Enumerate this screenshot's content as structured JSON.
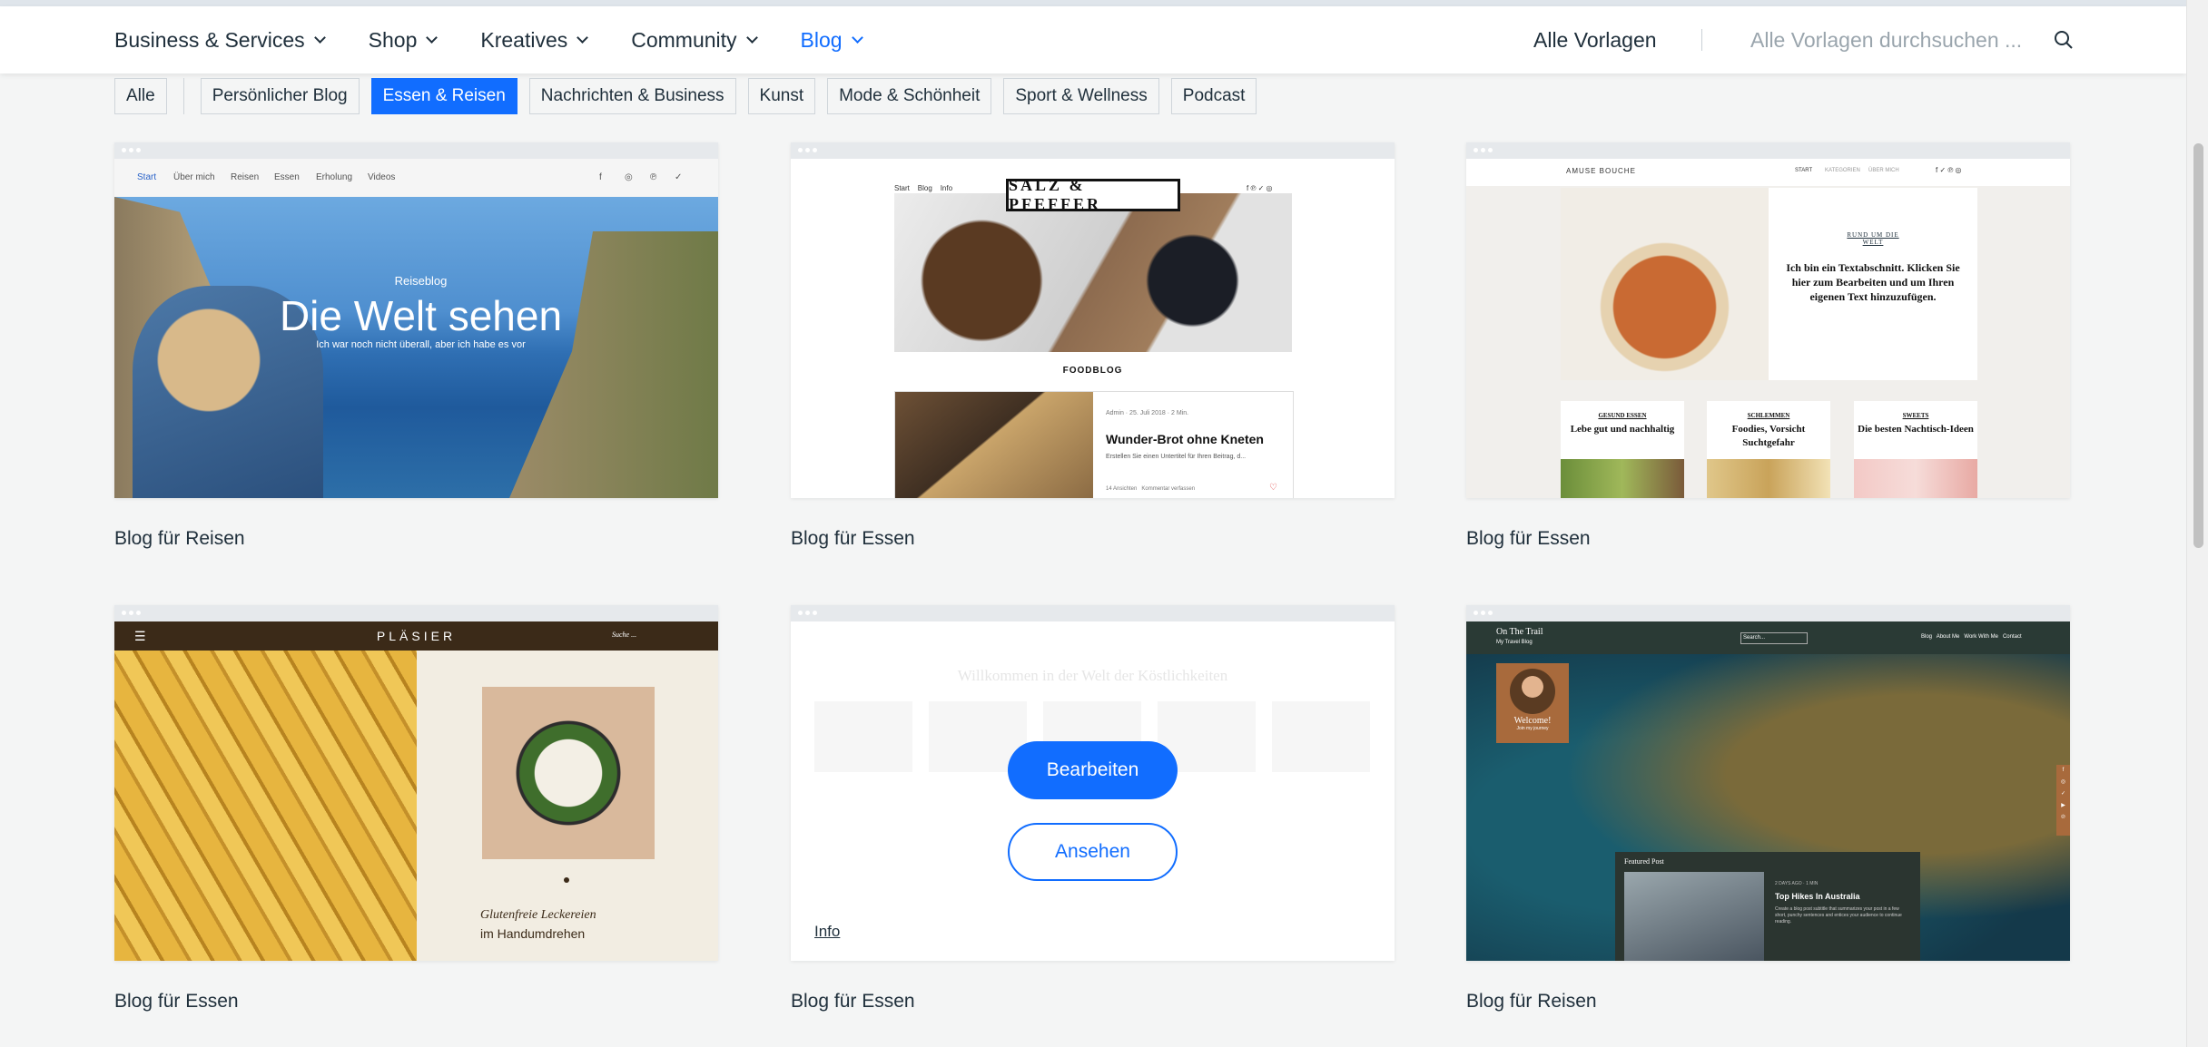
{
  "header": {
    "nav": [
      {
        "label": "Business & Services"
      },
      {
        "label": "Shop"
      },
      {
        "label": "Kreatives"
      },
      {
        "label": "Community"
      },
      {
        "label": "Blog"
      }
    ],
    "active_nav": "Blog",
    "all_templates": "Alle Vorlagen",
    "search_placeholder": "Alle Vorlagen durchsuchen ..."
  },
  "filters": {
    "all": "Alle",
    "items": [
      {
        "label": "Persönlicher Blog"
      },
      {
        "label": "Essen & Reisen"
      },
      {
        "label": "Nachrichten & Business"
      },
      {
        "label": "Kunst"
      },
      {
        "label": "Mode & Schönheit"
      },
      {
        "label": "Sport & Wellness"
      },
      {
        "label": "Podcast"
      }
    ],
    "active": "Essen & Reisen"
  },
  "cards": [
    {
      "title": "Blog für Reisen",
      "preview": {
        "nav": [
          "Start",
          "Über mich",
          "Reisen",
          "Essen",
          "Erholung",
          "Videos"
        ],
        "kicker": "Reiseblog",
        "headline": "Die Welt sehen",
        "tagline": "Ich war noch nicht überall, aber ich habe es vor"
      }
    },
    {
      "title": "Blog für Essen",
      "preview": {
        "nav": [
          "Start",
          "Blog",
          "Info"
        ],
        "logo": "SALZ & PFEFFER",
        "section": "FOODBLOG",
        "post_meta": "Admin · 25. Juli 2018 · 2 Min.",
        "post_title": "Wunder-Brot ohne Kneten",
        "post_excerpt": "Erstellen Sie einen Untertitel für Ihren Beitrag, d...",
        "post_stats": "14 Ansichten",
        "post_comments": "Kommentar verfassen"
      }
    },
    {
      "title": "Blog für Essen",
      "preview": {
        "brand": "AMUSE BOUCHE",
        "nav": [
          "START",
          "KATEGORIEN",
          "ÜBER MICH"
        ],
        "kicker": "RUND UM DIE WELT",
        "text": "Ich bin ein Textabschnitt. Klicken Sie hier zum Bearbeiten und um Ihren eigenen Text hinzuzufügen.",
        "cards": [
          {
            "label": "GESUND ESSEN",
            "title": "Lebe gut und nachhaltig"
          },
          {
            "label": "SCHLEMMEN",
            "title": "Foodies, Vorsicht Suchtgefahr"
          },
          {
            "label": "SWEETS",
            "title": "Die besten Nachtisch-Ideen"
          }
        ]
      }
    },
    {
      "title": "Blog für Essen",
      "preview": {
        "brand": "PLÄSIER",
        "search": "Suche ...",
        "caption_line1": "Glutenfreie Leckereien",
        "caption_line2": "im Handumdrehen"
      }
    },
    {
      "title": "Blog für Essen",
      "overlay": {
        "edit": "Bearbeiten",
        "view": "Ansehen",
        "info": "Info"
      },
      "preview": {
        "headline": "Willkommen in der Welt der Köstlichkeiten"
      }
    },
    {
      "title": "Blog für Reisen",
      "preview": {
        "brand": "On The Trail",
        "brand_sub": "My Travel Blog",
        "search": "Search...",
        "nav": [
          "Blog",
          "About Me",
          "Work With Me",
          "Contact"
        ],
        "welcome": "Welcome!",
        "welcome_sub": "Join my journey",
        "featured_label": "Featured Post",
        "featured_meta": "2 DAYS AGO · 1 MIN",
        "featured_title": "Top Hikes In Australia",
        "featured_excerpt": "Create a blog post subtitle that summarizes your post in a few short, punchy sentences and entices your audience to continue reading."
      }
    }
  ],
  "colors": {
    "accent": "#116dff",
    "text": "#20303c",
    "background": "#f4f5f5"
  }
}
